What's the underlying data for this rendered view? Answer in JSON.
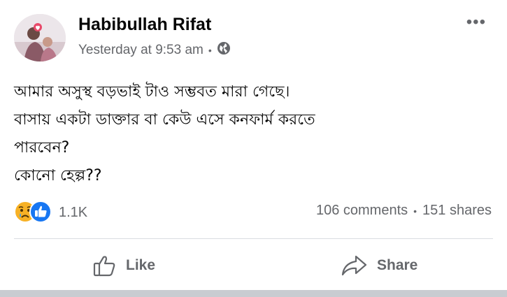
{
  "post": {
    "author_name": "Habibullah Rifat",
    "timestamp": "Yesterday at 9:53 am",
    "privacy_icon": "globe-icon",
    "menu_icon": "more-options-icon",
    "more_label": "•••",
    "dot": "•",
    "body_lines": [
      "আমার অসুস্থ বড়ভাই টাও সম্ভবত মারা গেছে।",
      "বাসায় একটা ডাক্তার বা কেউ এসে কনফার্ম করতে",
      "পারবেন?",
      "কোনো হেল্প??"
    ]
  },
  "engagement": {
    "reaction_icons": [
      "sad-reaction-icon",
      "like-reaction-icon"
    ],
    "reaction_count": "1.1K",
    "comments": "106 comments",
    "separator": "•",
    "shares": "151 shares"
  },
  "actions": {
    "like_label": "Like",
    "share_label": "Share"
  },
  "colors": {
    "secondary_text": "#65676b",
    "like_blue": "#1877f2",
    "reaction_yellow": "#f7b125",
    "divider": "#dadde1"
  }
}
